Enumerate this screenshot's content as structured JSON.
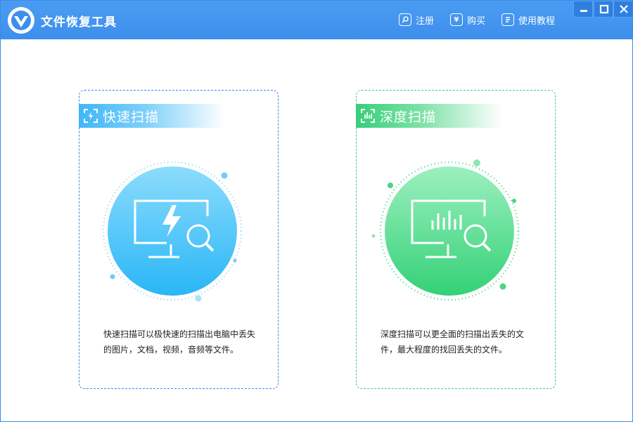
{
  "app": {
    "title": "文件恢复工具"
  },
  "menu": {
    "register": "注册",
    "buy": "购买",
    "tutorial": "使用教程",
    "buy_icon_glyph": "¥"
  },
  "window_controls": [
    "minimize",
    "maximize",
    "close"
  ],
  "cards": {
    "quick": {
      "title": "快速扫描",
      "description": "快速扫描可以极快速的扫描出电脑中丢失的图片，文档，视频，音频等文件。",
      "accent": "#3b8be0"
    },
    "deep": {
      "title": "深度扫描",
      "description": "深度扫描可以更全面的扫描出丢失的文件，最大程度的找回丢失的文件。",
      "accent": "#3fd07e"
    }
  },
  "colors": {
    "titlebar": "#4a9cf2",
    "quick_circle": "#5cc6fb",
    "deep_circle": "#3ed67f"
  }
}
